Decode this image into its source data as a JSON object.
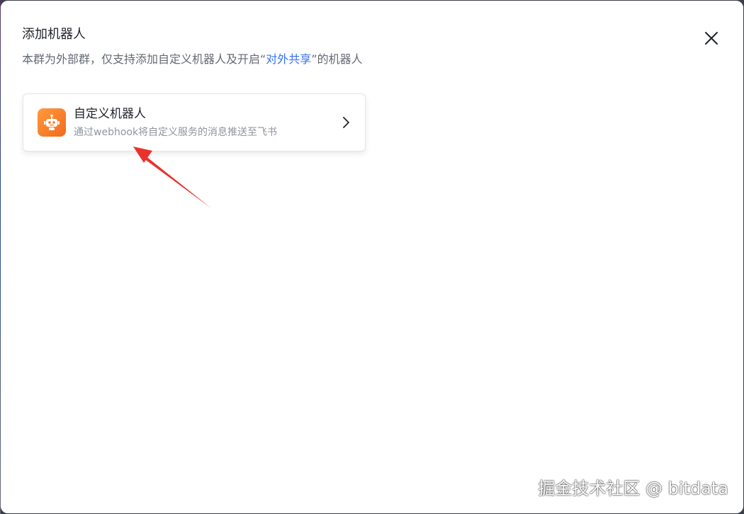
{
  "dialog": {
    "title": "添加机器人",
    "subtitle_prefix": "本群为外部群，仅支持添加自定义机器人及开启“",
    "subtitle_link": "对外共享",
    "subtitle_suffix": "”的机器人",
    "close_icon": "close-icon"
  },
  "robot_card": {
    "title": "自定义机器人",
    "description": "通过webhook将自定义服务的消息推送至飞书",
    "icon": "robot-icon",
    "chevron_icon": "chevron-right-icon",
    "icon_gradient": [
      "#ff9a3c",
      "#f26b1d"
    ]
  },
  "annotation": {
    "arrow_color": "#e8322b"
  },
  "watermark": {
    "text": "掘金技术社区 @ bitdata"
  }
}
